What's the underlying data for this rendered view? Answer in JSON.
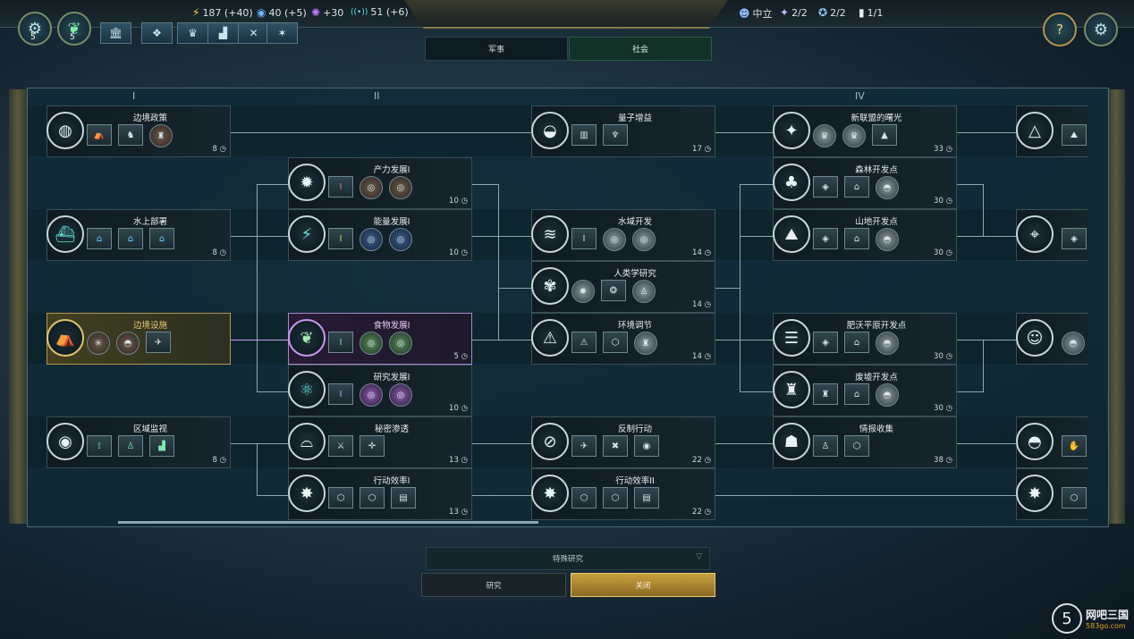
{
  "resources": [
    {
      "glyph": "⚡",
      "value": "187 (+40)",
      "color": "#ffd54a"
    },
    {
      "glyph": "◉",
      "value": "40 (+5)",
      "color": "#6fb2ff"
    },
    {
      "glyph": "✺",
      "value": "+30",
      "color": "#c07bff"
    },
    {
      "glyph": "((•))",
      "value": "51 (+6)",
      "color": "#5fe2d9"
    }
  ],
  "status": [
    {
      "glyph": "☻",
      "value": "中立",
      "color": "#8fb6ff"
    },
    {
      "glyph": "✦",
      "value": "2/2",
      "color": "#c9b8ff"
    },
    {
      "glyph": "✪",
      "value": "2/2",
      "color": "#8ad0ff"
    },
    {
      "glyph": "▮",
      "value": "1/1",
      "color": "#e7eef0"
    }
  ],
  "top_left": {
    "settings_count": "5",
    "leaf_count": "5"
  },
  "tabs": {
    "military": "军事",
    "society": "社会"
  },
  "tiers": [
    "I",
    "II",
    "IV"
  ],
  "cards": {
    "c1": {
      "title": "边境政策",
      "turns": "8"
    },
    "c2": {
      "title": "水上部署",
      "turns": "8"
    },
    "c3": {
      "title": "边境设施",
      "turns": ""
    },
    "c4": {
      "title": "区域监视",
      "turns": "8"
    },
    "c5": {
      "title": "产力发展I",
      "turns": "10"
    },
    "c6": {
      "title": "能量发展I",
      "turns": "10"
    },
    "c7": {
      "title": "食物发展I",
      "turns": "5"
    },
    "c8": {
      "title": "研究发展I",
      "turns": "10"
    },
    "c9": {
      "title": "秘密渗透",
      "turns": "13"
    },
    "c10": {
      "title": "行动效率I",
      "turns": "13"
    },
    "c11": {
      "title": "量子增益",
      "turns": "17"
    },
    "c12": {
      "title": "水域开发",
      "turns": "14"
    },
    "c13": {
      "title": "人类学研究",
      "turns": "14"
    },
    "c14": {
      "title": "环境调节",
      "turns": "14"
    },
    "c15": {
      "title": "反制行动",
      "turns": "22"
    },
    "c16": {
      "title": "行动效率II",
      "turns": "22"
    },
    "c17": {
      "title": "新联盟的曙光",
      "turns": "33"
    },
    "c18": {
      "title": "森林开发点",
      "turns": "30"
    },
    "c19": {
      "title": "山地开发点",
      "turns": "30"
    },
    "c20": {
      "title": "肥沃平原开发点",
      "turns": "30"
    },
    "c21": {
      "title": "废墟开发点",
      "turns": "30"
    },
    "c22": {
      "title": "情报收集",
      "turns": "38"
    }
  },
  "bottom": {
    "dropdown": "特殊研究",
    "research": "研究",
    "close": "关闭"
  },
  "watermark": {
    "logo": "5",
    "name": "网吧三国",
    "url": "583go.com"
  }
}
